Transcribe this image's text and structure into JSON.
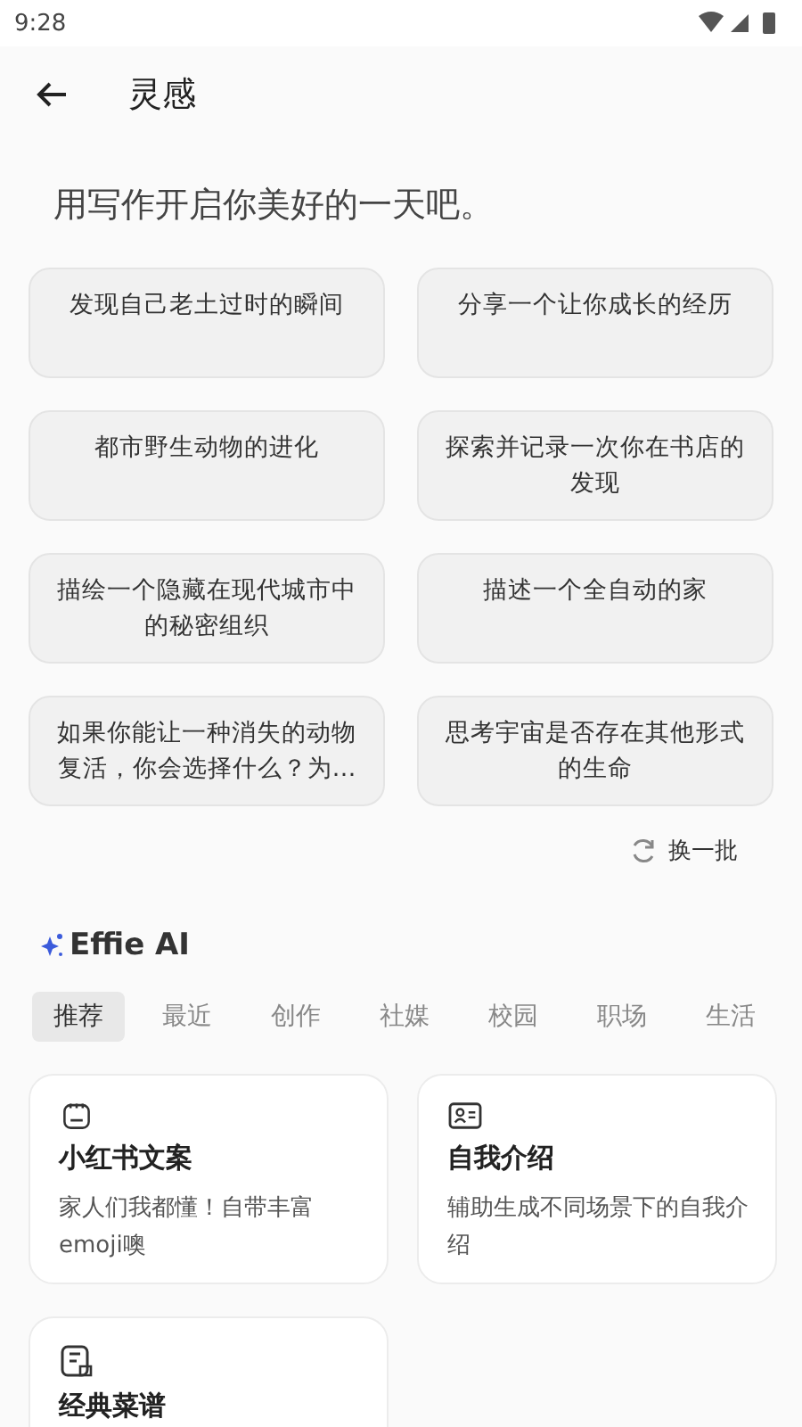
{
  "status_bar": {
    "time": "9:28"
  },
  "header": {
    "title": "灵感"
  },
  "prompt": "用写作开启你美好的一天吧。",
  "ideas": [
    {
      "text": "发现自己老土过时的瞬间"
    },
    {
      "text": "分享一个让你成长的经历"
    },
    {
      "text": "都市野生动物的进化"
    },
    {
      "text": "探索并记录一次你在书店的发现"
    },
    {
      "text": "描绘一个隐藏在现代城市中的秘密组织"
    },
    {
      "text": "描述一个全自动的家"
    },
    {
      "text": "如果你能让一种消失的动物复活，你会选择什么？为…"
    },
    {
      "text": "思考宇宙是否存在其他形式的生命"
    }
  ],
  "refresh_label": "换一批",
  "ai": {
    "title": "Effie AI"
  },
  "tabs": [
    {
      "label": "推荐",
      "selected": true
    },
    {
      "label": "最近",
      "selected": false
    },
    {
      "label": "创作",
      "selected": false
    },
    {
      "label": "社媒",
      "selected": false
    },
    {
      "label": "校园",
      "selected": false
    },
    {
      "label": "职场",
      "selected": false
    },
    {
      "label": "生活",
      "selected": false
    }
  ],
  "templates": [
    {
      "kind": "note",
      "title": "小红书文案",
      "description": "家人们我都懂！自带丰富emoji噢"
    },
    {
      "kind": "profile",
      "title": "自我介绍",
      "description": "辅助生成不同场景下的自我介绍"
    },
    {
      "kind": "recipe",
      "title": "经典菜谱"
    }
  ]
}
